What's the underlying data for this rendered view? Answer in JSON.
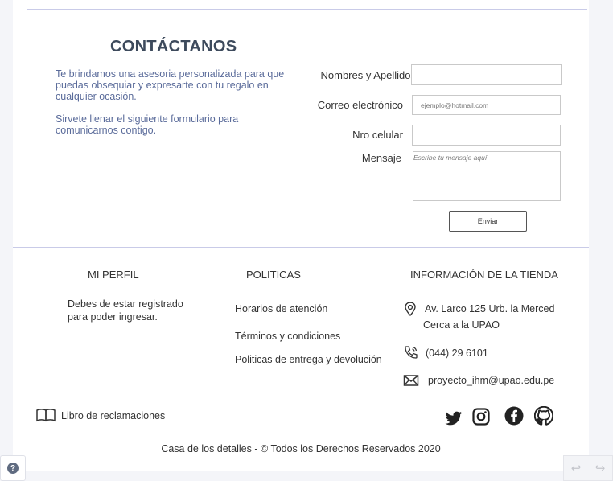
{
  "contact": {
    "title": "CONTÁCTANOS",
    "intro": "Te brindamos  una asesoria personalizada para que puedas obsequiar y expresarte con tu regalo en  cualquier ocasión.",
    "form_hint": "Sirvete llenar el siguiente formulario para comunicarnos contigo.",
    "form": {
      "name_label": "Nombres y Apellidos",
      "name_value": "",
      "email_label": "Correo electrónico",
      "email_placeholder": "ejemplo@hotmail.com",
      "email_value": "",
      "phone_label": "Nro celular",
      "phone_value": "",
      "message_label": "Mensaje",
      "message_placeholder": "Escribe tu mensaje aquí",
      "submit_label": "Enviar"
    }
  },
  "footer": {
    "profile": {
      "heading": "MI PERFIL",
      "text_line1": "Debes de estar registrado",
      "text_line2": "para poder ingresar."
    },
    "policies": {
      "heading": "POLITICAS",
      "links": [
        "Horarios de atención",
        "Términos y condiciones",
        "Politicas de entrega y devolución"
      ]
    },
    "store": {
      "heading": "INFORMACIÓN DE LA TIENDA",
      "address_line1": "Av. Larco 125 Urb. la Merced",
      "address_line2": "Cerca a la UPAO",
      "phone": "(044) 29 6101",
      "email": "proyecto_ihm@upao.edu.pe"
    },
    "complaints_label": "Libro de reclamaciones",
    "social": [
      "twitter-icon",
      "instagram-icon",
      "facebook-icon",
      "github-icon"
    ],
    "copyright": "Casa de los detalles -  © Todos los Derechos Reservados 2020"
  },
  "widgets": {
    "help_symbol": "?",
    "back_arrow": "↩",
    "forward_arrow": "↪"
  },
  "colors": {
    "accent_text": "#5a6b9a",
    "title": "#3d4a5c",
    "divider": "#c9cbe8",
    "page_bg": "#f4f5f9"
  }
}
